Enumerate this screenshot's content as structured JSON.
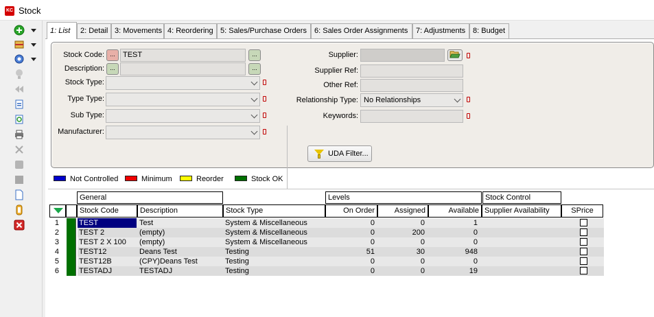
{
  "window": {
    "title": "Stock",
    "logo_text": "KC"
  },
  "toolbar": {
    "icons": [
      "add-icon",
      "stock-icon",
      "settings-icon",
      "lamp-icon",
      "rewind-icon",
      "import-icon",
      "refresh-icon",
      "print-icon",
      "tools-icon",
      "stop-icon",
      "square-icon",
      "document-icon",
      "clip-icon",
      "close-icon"
    ]
  },
  "tabs": [
    {
      "label": "1: List",
      "active": true
    },
    {
      "label": "2: Detail"
    },
    {
      "label": "3: Movements"
    },
    {
      "label": "4: Reordering"
    },
    {
      "label": "5: Sales/Purchase Orders"
    },
    {
      "label": "6: Sales Order Assignments"
    },
    {
      "label": "7: Adjustments"
    },
    {
      "label": "8: Budget"
    }
  ],
  "filters": {
    "stock_code_label": "Stock Code:",
    "stock_code_value": "TEST",
    "description_label": "Description:",
    "description_value": "",
    "stock_type_label": "Stock Type:",
    "type_type_label": "Type Type:",
    "sub_type_label": "Sub Type:",
    "manufacturer_label": "Manufacturer:",
    "supplier_label": "Supplier:",
    "supplier_ref_label": "Supplier Ref:",
    "other_ref_label": "Other Ref:",
    "relationship_type_label": "Relationship Type:",
    "relationship_type_value": "No Relationships",
    "keywords_label": "Keywords:",
    "uda_filter_label": "UDA Filter...",
    "btn_dots": "..."
  },
  "legend": [
    {
      "label": "Not Controlled",
      "color": "#0000cc"
    },
    {
      "label": "Minimum",
      "color": "#ee0000"
    },
    {
      "label": "Reorder",
      "color": "#ffff00"
    },
    {
      "label": "Stock OK",
      "color": "#007000"
    }
  ],
  "grid": {
    "groups": {
      "general": "General",
      "levels": "Levels",
      "stock_control": "Stock Control"
    },
    "columns": {
      "stock_code": "Stock Code",
      "description": "Description",
      "stock_type": "Stock Type",
      "on_order": "On Order",
      "assigned": "Assigned",
      "available": "Available",
      "supplier_availability": "Supplier Availability",
      "sprice": "SPrice"
    },
    "rows": [
      {
        "n": "1",
        "code": "TEST",
        "description": "Test",
        "stock_type": "System & Miscellaneous",
        "on_order": "0",
        "assigned": "0",
        "available": "1",
        "selected": true
      },
      {
        "n": "2",
        "code": "TEST 2",
        "description": "(empty)",
        "stock_type": "System & Miscellaneous",
        "on_order": "0",
        "assigned": "200",
        "available": "0"
      },
      {
        "n": "3",
        "code": "TEST 2 X 100",
        "description": "(empty)",
        "stock_type": "System & Miscellaneous",
        "on_order": "0",
        "assigned": "0",
        "available": "0"
      },
      {
        "n": "4",
        "code": "TEST12",
        "description": "Deans Test",
        "stock_type": "Testing",
        "on_order": "51",
        "assigned": "30",
        "available": "948"
      },
      {
        "n": "5",
        "code": "TEST12B",
        "description": "(CPY)Deans Test",
        "stock_type": "Testing",
        "on_order": "0",
        "assigned": "0",
        "available": "0"
      },
      {
        "n": "6",
        "code": "TESTADJ",
        "description": "TESTADJ",
        "stock_type": "Testing",
        "on_order": "0",
        "assigned": "0",
        "available": "19"
      }
    ]
  }
}
